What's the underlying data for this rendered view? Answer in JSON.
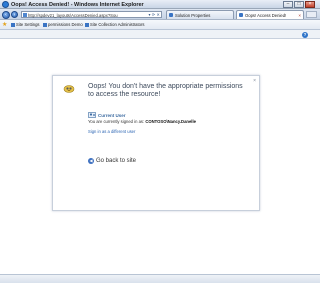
{
  "window": {
    "title": "Oops! Access Denied! - Windows Internet Explorer"
  },
  "navigation": {
    "address_url": "http://spdev21_layouts/AccessDenied.aspx?Sou",
    "tabs": [
      {
        "label": "Solution Properties",
        "active": false
      },
      {
        "label": "Oops! Access Denied!",
        "active": true
      }
    ]
  },
  "favorites": {
    "items": [
      {
        "label": "Site Settings"
      },
      {
        "label": "permissions Demo"
      },
      {
        "label": "Site Collection Administrators"
      }
    ]
  },
  "dialog": {
    "message": "Oops! You don't have the appropriate permissions to access the resource!",
    "current_user_label": "Current User",
    "signed_in_text": "You are currently signed in as:",
    "signed_in_user": "CONTOSO\\Nancy.Danelle",
    "sign_in_different": "Sign in as a different user",
    "back_label": "Go back to site"
  },
  "colors": {
    "accent": "#2a64b3",
    "title_text": "#3d4a5c"
  }
}
